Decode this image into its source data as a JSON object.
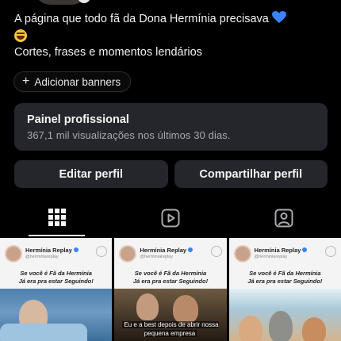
{
  "profile": {
    "bio_line1": "A página que todo fã da Dona Hermínia precisava",
    "bio_line2": "Cortes, frases e momentos lendários",
    "add_banners_label": "Adicionar banners"
  },
  "panel": {
    "title": "Painel profissional",
    "subtitle": "367,1 mil visualizações nos últimos 30 dias."
  },
  "actions": {
    "edit_label": "Editar perfil",
    "share_label": "Compartilhar perfil"
  },
  "tabs": [
    {
      "icon": "grid-icon",
      "active": true
    },
    {
      "icon": "reels-icon",
      "active": false
    },
    {
      "icon": "tagged-icon",
      "active": false
    }
  ],
  "posts": [
    {
      "account_name": "Hermínia Replay",
      "handle": "@herminiareplay",
      "caption_line1": "Se você é Fã da Hermínia",
      "caption_line2": "Já era pra estar Seguindo!",
      "subtitle": ""
    },
    {
      "account_name": "Hermínia Replay",
      "handle": "@herminiareplay",
      "caption_line1": "Se você é Fã da Hermínia",
      "caption_line2": "Já era pra estar Seguindo!",
      "subtitle": "Eu e a best depois de abrir nossa pequena empresa"
    },
    {
      "account_name": "Hermínia Replay",
      "handle": "@herminiareplay",
      "caption_line1": "Se você é Fã da Hermínia",
      "caption_line2": "Já era pra estar Seguindo!",
      "subtitle": ""
    }
  ],
  "colors": {
    "background": "#000000",
    "surface": "#24262b",
    "text_primary": "#f5f5f5",
    "text_secondary": "#a8a9ad",
    "heart": "#3b82f6"
  }
}
